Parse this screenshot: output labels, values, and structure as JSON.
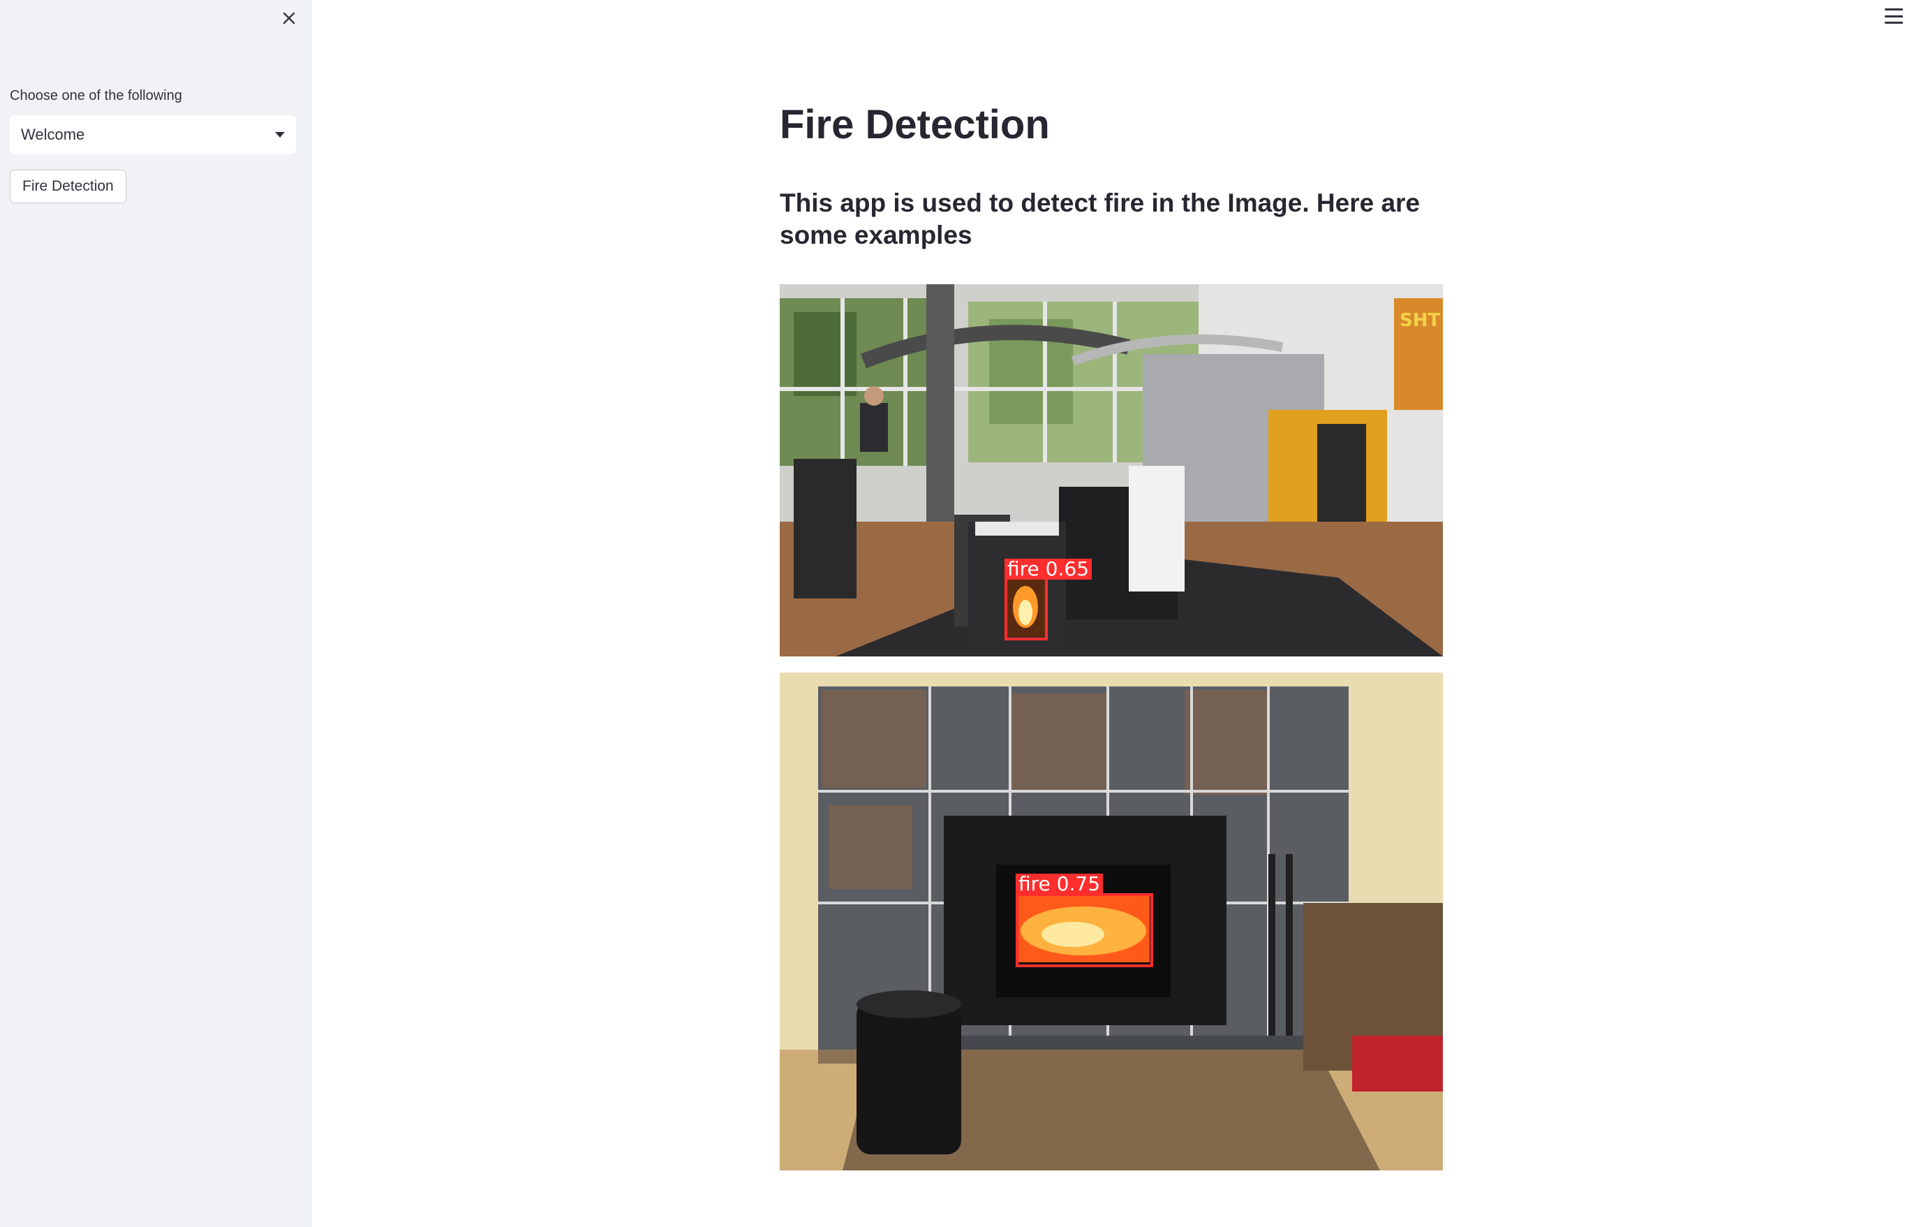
{
  "sidebar": {
    "select_label": "Choose one of the following",
    "select_value": "Welcome",
    "button_label": "Fire Detection"
  },
  "main": {
    "title": "Fire Detection",
    "subtitle": "This app is used to detect fire in the Image. Here are some examples",
    "examples": [
      {
        "detection_label": "fire  0.65"
      },
      {
        "detection_label": "fire  0.75"
      }
    ]
  },
  "icons": {
    "close": "close-icon",
    "menu": "hamburger-menu-icon",
    "dropdown": "chevron-down-icon"
  },
  "colors": {
    "sidebar_bg": "#f0f2f6",
    "text": "#262730",
    "detection": "#ff2e2e"
  }
}
